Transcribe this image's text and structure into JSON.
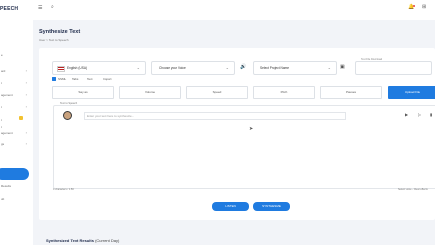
{
  "sidebar": {
    "brand": "PEECH",
    "items": [
      {
        "label": "e"
      },
      {
        "label": "ard"
      },
      {
        "label": "t"
      },
      {
        "label": "agement"
      },
      {
        "label": "t"
      },
      {
        "label": "t"
      },
      {
        "label": "t"
      },
      {
        "label": "agement"
      },
      {
        "label": "gs"
      }
    ],
    "active_label": "",
    "sub_items": [
      "Results",
      "ult"
    ]
  },
  "page": {
    "title": "Synthesize Text",
    "breadcrumb": "User  >  Text to Speech"
  },
  "form": {
    "language": "English (USA)",
    "voice_placeholder": "Choose your Voice",
    "project_placeholder": "Select Project Name",
    "fieldset_label": "Text File Download",
    "options": [
      "SSML",
      "Tabs",
      "Text",
      "Import"
    ]
  },
  "tabs": [
    "Say as",
    "Volume",
    "Speed",
    "Pitch",
    "Pauses",
    "Upload File"
  ],
  "editor": {
    "label": "Text to Speech",
    "placeholder": "Enter your text here to synthesize...",
    "footer_left": "0 characters / 1.5K",
    "footer_right": "Select voice - Clear effects"
  },
  "buttons": {
    "listen": "LISTEN",
    "synthesize": "SYNTHESIZE"
  },
  "results": {
    "title": "Synthesized Text Results",
    "subtitle": "(Current Day)"
  },
  "colors": {
    "accent": "#1f7be0",
    "sidebar_bg": "#ffffff",
    "page_bg": "#f2f4f8"
  }
}
